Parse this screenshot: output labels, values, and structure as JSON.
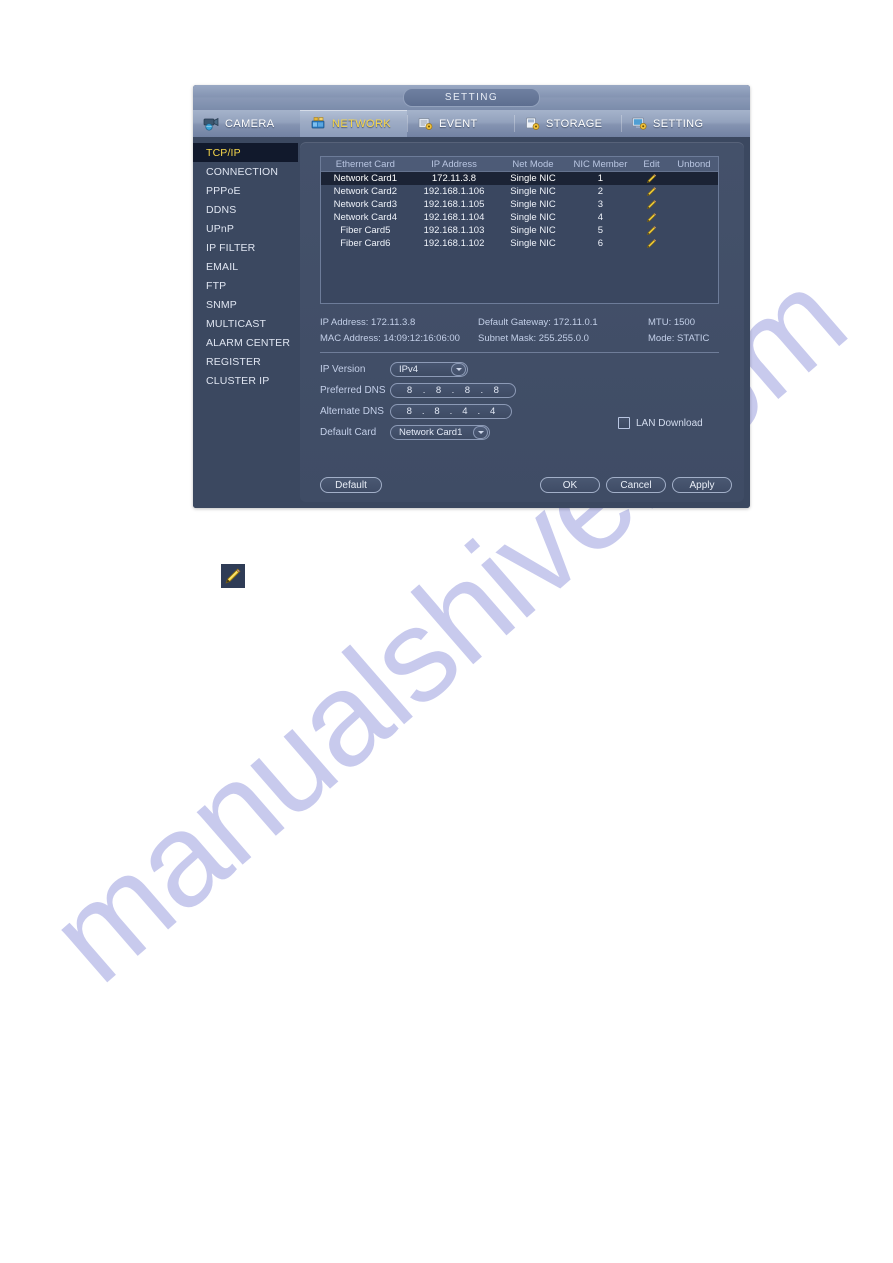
{
  "window": {
    "title": "SETTING"
  },
  "tabs": [
    {
      "label": "CAMERA",
      "icon": "camera-icon",
      "active": false
    },
    {
      "label": "NETWORK",
      "icon": "network-icon",
      "active": true
    },
    {
      "label": "EVENT",
      "icon": "event-icon",
      "active": false
    },
    {
      "label": "STORAGE",
      "icon": "storage-icon",
      "active": false
    },
    {
      "label": "SETTING",
      "icon": "setting-icon",
      "active": false
    }
  ],
  "sidebar": {
    "items": [
      {
        "label": "TCP/IP",
        "active": true
      },
      {
        "label": "CONNECTION",
        "active": false
      },
      {
        "label": "PPPoE",
        "active": false
      },
      {
        "label": "DDNS",
        "active": false
      },
      {
        "label": "UPnP",
        "active": false
      },
      {
        "label": "IP FILTER",
        "active": false
      },
      {
        "label": "EMAIL",
        "active": false
      },
      {
        "label": "FTP",
        "active": false
      },
      {
        "label": "SNMP",
        "active": false
      },
      {
        "label": "MULTICAST",
        "active": false
      },
      {
        "label": "ALARM CENTER",
        "active": false
      },
      {
        "label": "REGISTER",
        "active": false
      },
      {
        "label": "CLUSTER IP",
        "active": false
      }
    ]
  },
  "nic_table": {
    "columns": [
      "Ethernet Card",
      "IP Address",
      "Net Mode",
      "NIC Member",
      "Edit",
      "Unbond"
    ],
    "rows": [
      {
        "card": "Network Card1",
        "ip": "172.11.3.8",
        "mode": "Single NIC",
        "member": "1",
        "edit": "pencil-icon",
        "unbond": "",
        "selected": true
      },
      {
        "card": "Network Card2",
        "ip": "192.168.1.106",
        "mode": "Single NIC",
        "member": "2",
        "edit": "pencil-icon",
        "unbond": "",
        "selected": false
      },
      {
        "card": "Network Card3",
        "ip": "192.168.1.105",
        "mode": "Single NIC",
        "member": "3",
        "edit": "pencil-icon",
        "unbond": "",
        "selected": false
      },
      {
        "card": "Network Card4",
        "ip": "192.168.1.104",
        "mode": "Single NIC",
        "member": "4",
        "edit": "pencil-icon",
        "unbond": "",
        "selected": false
      },
      {
        "card": "Fiber Card5",
        "ip": "192.168.1.103",
        "mode": "Single NIC",
        "member": "5",
        "edit": "pencil-icon",
        "unbond": "",
        "selected": false
      },
      {
        "card": "Fiber Card6",
        "ip": "192.168.1.102",
        "mode": "Single NIC",
        "member": "6",
        "edit": "pencil-icon",
        "unbond": "",
        "selected": false
      }
    ]
  },
  "info": {
    "ip_address": "IP Address: 172.11.3.8",
    "default_gateway": "Default Gateway: 172.11.0.1",
    "mtu": "MTU: 1500",
    "mac_address": "MAC Address: 14:09:12:16:06:00",
    "subnet_mask": "Subnet Mask: 255.255.0.0",
    "mode": "Mode: STATIC"
  },
  "form": {
    "ip_version_label": "IP Version",
    "ip_version_value": "IPv4",
    "preferred_dns_label": "Preferred DNS",
    "preferred_dns": [
      "8",
      "8",
      "8",
      "8"
    ],
    "alternate_dns_label": "Alternate DNS",
    "alternate_dns": [
      "8",
      "8",
      "4",
      "4"
    ],
    "default_card_label": "Default Card",
    "default_card_value": "Network Card1",
    "lan_download_label": "LAN Download",
    "lan_download_checked": false
  },
  "buttons": {
    "default": "Default",
    "ok": "OK",
    "cancel": "Cancel",
    "apply": "Apply"
  },
  "standalone_icon": {
    "name": "pencil-icon"
  },
  "watermark": {
    "text": "manualshive.com"
  },
  "colors": {
    "accent_yellow": "#f6d64a",
    "dialog_bg": "#3b4860",
    "panel_bg": "#44516a",
    "selected_row": "#1b2335",
    "text_light": "#e4eaf6",
    "text_muted": "#c3cfe8",
    "pencil": "#e8c43a"
  }
}
